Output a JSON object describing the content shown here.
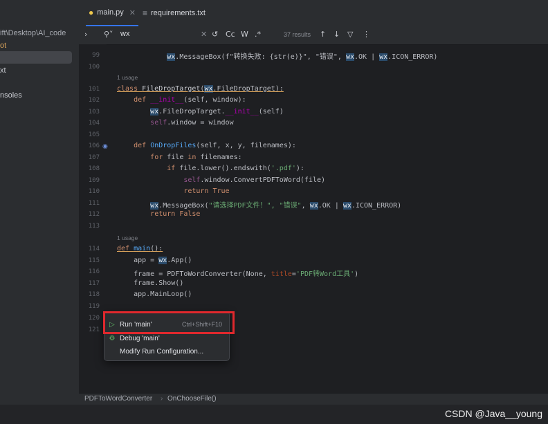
{
  "sidebar": {
    "path": "\\Desktop\\AI_code",
    "path_prefix": "ift",
    "tag": "ot",
    "items": [
      "xt",
      "nsoles"
    ]
  },
  "tabs": [
    {
      "label": "main.py",
      "active": true
    },
    {
      "label": "requirements.txt",
      "active": false
    }
  ],
  "find": {
    "query": "wx",
    "results": "37 results",
    "cc": "Cc",
    "w": "W",
    "regex": ".*"
  },
  "gutter": [
    "99",
    "100",
    "101",
    "102",
    "103",
    "104",
    "105",
    "106",
    "107",
    "108",
    "109",
    "110",
    "111",
    "112",
    "113",
    "114",
    "115",
    "116",
    "117",
    "118",
    "119",
    "120",
    "121"
  ],
  "hints": {
    "usage1": "1 usage",
    "usage2": "1 usage"
  },
  "code": {
    "l99_a": "wx",
    "l99_b": ".MessageBox(f\"转换失败: {str(e)}\", \"错误\", ",
    "l99_c": "wx",
    "l99_d": ".OK | ",
    "l99_e": "wx",
    "l99_f": ".ICON_ERROR)",
    "l101_kw": "class ",
    "l101_name": "FileDropTarget",
    "l101_p": "(",
    "l101_wx": "wx",
    "l101_rest": ".FileDropTarget):",
    "l102_kw": "def ",
    "l102_name": "__init__",
    "l102_rest": "(self, window):",
    "l103_wx": "wx",
    "l103_a": ".FileDropTarget.",
    "l103_init": "__init__",
    "l103_b": "(self)",
    "l104_self": "self",
    "l104_rest": ".window = window",
    "l106_kw": "def ",
    "l106_name": "OnDropFiles",
    "l106_rest": "(self, x, y, filenames):",
    "l107_kw": "for ",
    "l107_rest": "file ",
    "l107_in": "in ",
    "l107_rest2": "filenames:",
    "l108_kw": "if ",
    "l108_rest": "file.lower().endswith(",
    "l108_str": "'.pdf'",
    "l108_end": "):",
    "l109_self": "self",
    "l109_rest": ".window.ConvertPDFToWord(file)",
    "l110_kw": "return ",
    "l110_val": "True",
    "l111_wx": "wx",
    "l111_a": ".MessageBox(",
    "l111_str": "\"请选择PDF文件！\", \"错误\"",
    "l111_b": ", ",
    "l111_wx2": "wx",
    "l111_c": ".OK | ",
    "l111_wx3": "wx",
    "l111_d": ".ICON_ERROR)",
    "l112_kw": "return ",
    "l112_val": "False",
    "l114_kw": "def ",
    "l114_name": "main",
    "l114_rest": "():",
    "l115_a": "app = ",
    "l115_wx": "wx",
    "l115_b": ".App()",
    "l116_a": "frame = PDFToWordConverter(None, ",
    "l116_param": "title",
    "l116_eq": "=",
    "l116_str": "'PDF转Word工具'",
    "l116_end": ")",
    "l117": "frame.Show()",
    "l118": "app.MainLoop()"
  },
  "menu": {
    "run_label": "Run 'main'",
    "run_shortcut": "Ctrl+Shift+F10",
    "debug_label": "Debug 'main'",
    "modify_label": "Modify Run Configuration..."
  },
  "status": {
    "crumb1": "PDFToWordConverter",
    "crumb2": "OnChooseFile()"
  },
  "watermark": "CSDN @Java__young",
  "colors": {
    "accent": "#3574f0",
    "highlight_box": "#e0282d",
    "keyword": "#cf8e6d",
    "function": "#56a8f5",
    "string": "#6aab73"
  },
  "icons": [
    "python-file-icon",
    "text-file-icon",
    "search-icon",
    "close-icon",
    "run-icon",
    "debug-icon",
    "override-icon"
  ]
}
